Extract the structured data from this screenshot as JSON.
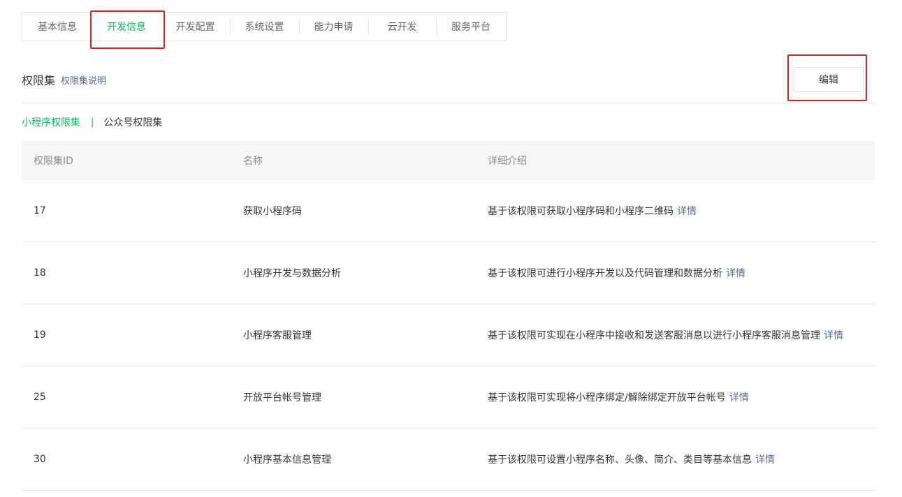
{
  "tabs": [
    {
      "label": "基本信息",
      "active": false
    },
    {
      "label": "开发信息",
      "active": true
    },
    {
      "label": "开发配置",
      "active": false
    },
    {
      "label": "系统设置",
      "active": false
    },
    {
      "label": "能力申请",
      "active": false
    },
    {
      "label": "云开发",
      "active": false
    },
    {
      "label": "服务平台",
      "active": false
    }
  ],
  "section": {
    "title": "权限集",
    "help_link": "权限集说明",
    "edit_label": "编辑"
  },
  "subtabs": {
    "miniprogram": "小程序权限集",
    "separator": "|",
    "official_account": "公众号权限集"
  },
  "table": {
    "headers": {
      "id": "权限集ID",
      "name": "名称",
      "desc": "详细介绍"
    },
    "detail_label": "详情",
    "rows": [
      {
        "id": "17",
        "name": "获取小程序码",
        "desc": "基于该权限可获取小程序码和小程序二维码"
      },
      {
        "id": "18",
        "name": "小程序开发与数据分析",
        "desc": "基于该权限可进行小程序开发以及代码管理和数据分析"
      },
      {
        "id": "19",
        "name": "小程序客服管理",
        "desc": "基于该权限可实现在小程序中接收和发送客服消息以进行小程序客服消息管理"
      },
      {
        "id": "25",
        "name": "开放平台帐号管理",
        "desc": "基于该权限可实现将小程序绑定/解除绑定开放平台帐号"
      },
      {
        "id": "30",
        "name": "小程序基本信息管理",
        "desc": "基于该权限可设置小程序名称、头像、简介、类目等基本信息"
      }
    ]
  },
  "colors": {
    "accent": "#07c160",
    "link": "#576b95",
    "highlight": "#e2231a"
  }
}
